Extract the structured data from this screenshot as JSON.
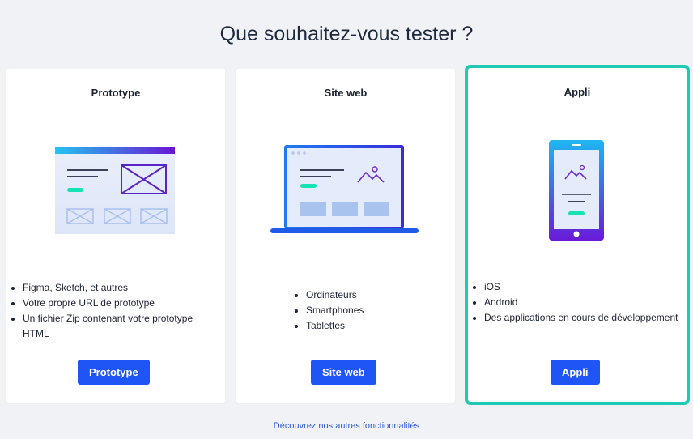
{
  "page": {
    "title": "Que souhaitez-vous tester ?"
  },
  "cards": [
    {
      "title": "Prototype",
      "features": [
        "Figma, Sketch, et autres",
        "Votre propre URL de prototype",
        "Un fichier Zip contenant votre prototype HTML"
      ],
      "button": "Prototype",
      "illustration": "prototype-wireframe-illustration",
      "selected": false
    },
    {
      "title": "Site web",
      "features": [
        "Ordinateurs",
        "Smartphones",
        "Tablettes"
      ],
      "button": "Site web",
      "illustration": "laptop-illustration",
      "selected": false
    },
    {
      "title": "Appli",
      "features": [
        "iOS",
        "Android",
        "Des applications en cours de développement"
      ],
      "button": "Appli",
      "illustration": "smartphone-illustration",
      "selected": true
    }
  ],
  "footer": {
    "link": "Découvrez nos autres fonctionnalités"
  },
  "colors": {
    "accent": "#1f55f5",
    "selection": "#20c9b4",
    "background": "#f0f2f5"
  }
}
